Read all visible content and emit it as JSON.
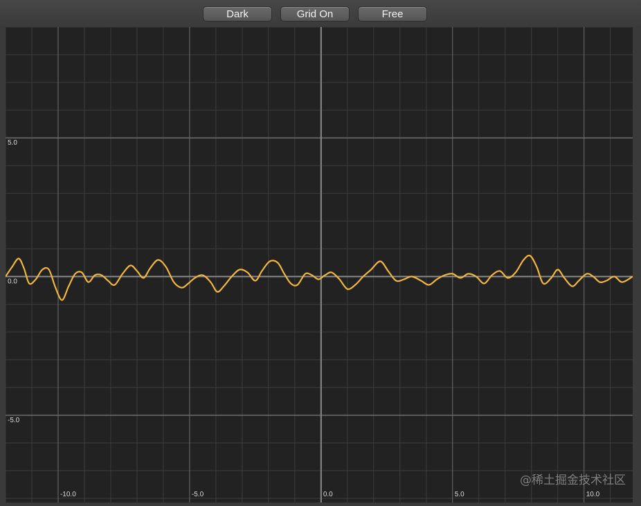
{
  "toolbar": {
    "theme_label": "Dark",
    "grid_label": "Grid On",
    "mode_label": "Free"
  },
  "watermark": "@稀土掘金技术社区",
  "colors": {
    "background": "#222222",
    "grid_minor": "#3c3c3c",
    "grid_major": "#6e6e6e",
    "axis": "#8a8a8a",
    "curve": "#f2b63c",
    "tick_label": "#dcdcdc"
  },
  "chart_data": {
    "type": "line",
    "title": "",
    "xlabel": "",
    "ylabel": "",
    "xlim": [
      -12.0,
      11.85
    ],
    "ylim": [
      -8.15,
      9.0
    ],
    "grid": true,
    "x_ticks": [
      -10.0,
      -5.0,
      0.0,
      5.0,
      10.0
    ],
    "x_tick_labels": [
      "-10.0",
      "-5.0",
      "0.0",
      "5.0",
      "10.0"
    ],
    "y_ticks": [
      5.0,
      0.0,
      -5.0
    ],
    "y_tick_labels": [
      "5.0",
      "0.0",
      "-5.0"
    ],
    "series": [
      {
        "name": "",
        "x": [
          -12.0,
          -11.75,
          -11.5,
          -11.3,
          -11.1,
          -10.85,
          -10.6,
          -10.35,
          -10.1,
          -9.85,
          -9.6,
          -9.35,
          -9.1,
          -8.85,
          -8.6,
          -8.35,
          -8.1,
          -7.85,
          -7.55,
          -7.25,
          -7.0,
          -6.75,
          -6.5,
          -6.2,
          -5.9,
          -5.6,
          -5.3,
          -5.05,
          -4.8,
          -4.5,
          -4.2,
          -3.95,
          -3.7,
          -3.4,
          -3.1,
          -2.8,
          -2.5,
          -2.25,
          -1.95,
          -1.65,
          -1.4,
          -1.15,
          -0.9,
          -0.6,
          -0.35,
          -0.1,
          0.15,
          0.4,
          0.7,
          1.0,
          1.3,
          1.6,
          1.9,
          2.25,
          2.55,
          2.85,
          3.15,
          3.45,
          3.8,
          4.1,
          4.4,
          4.7,
          5.0,
          5.3,
          5.6,
          5.9,
          6.2,
          6.5,
          6.8,
          7.1,
          7.4,
          7.7,
          7.95,
          8.2,
          8.45,
          8.75,
          9.0,
          9.25,
          9.55,
          9.8,
          10.1,
          10.35,
          10.6,
          10.85,
          11.15,
          11.45,
          11.85
        ],
        "y": [
          0.0,
          0.35,
          0.65,
          0.3,
          -0.25,
          -0.1,
          0.25,
          0.25,
          -0.4,
          -0.85,
          -0.35,
          0.1,
          0.15,
          -0.2,
          0.05,
          0.05,
          -0.15,
          -0.3,
          0.1,
          0.4,
          0.2,
          -0.05,
          0.3,
          0.6,
          0.35,
          -0.2,
          -0.4,
          -0.25,
          -0.05,
          0.05,
          -0.2,
          -0.55,
          -0.35,
          0.0,
          0.25,
          0.15,
          -0.15,
          0.2,
          0.55,
          0.5,
          0.1,
          -0.25,
          -0.3,
          0.1,
          0.05,
          -0.1,
          0.05,
          0.15,
          -0.1,
          -0.45,
          -0.3,
          0.0,
          0.25,
          0.55,
          0.2,
          -0.15,
          -0.1,
          0.0,
          -0.15,
          -0.3,
          -0.1,
          0.05,
          0.1,
          -0.05,
          0.1,
          0.0,
          -0.25,
          0.05,
          0.2,
          -0.05,
          0.15,
          0.6,
          0.75,
          0.35,
          -0.25,
          -0.05,
          0.25,
          -0.05,
          -0.35,
          -0.15,
          0.1,
          0.0,
          -0.2,
          -0.15,
          0.0,
          -0.2,
          0.0
        ]
      }
    ]
  }
}
